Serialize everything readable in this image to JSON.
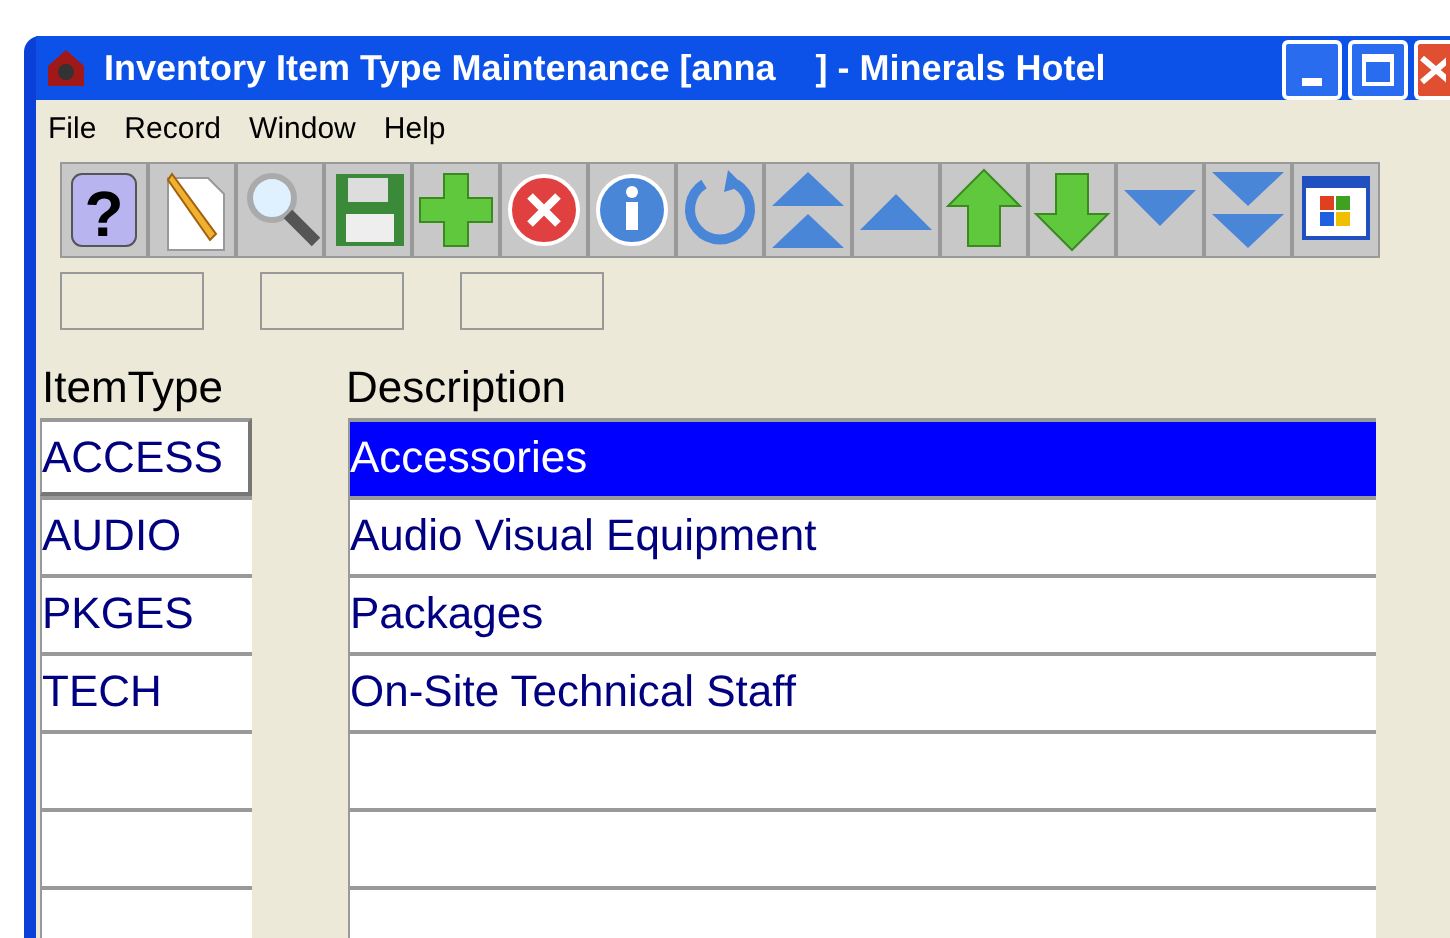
{
  "window": {
    "title": "Inventory Item Type Maintenance [anna    ] - Minerals Hotel"
  },
  "menu": [
    "File",
    "Record",
    "Window",
    "Help"
  ],
  "toolbar": {
    "help_glyph": "?"
  },
  "columns": [
    "ItemType",
    "Description"
  ],
  "rows": [
    {
      "item_type": "ACCESS",
      "description": "Accessories",
      "selected": true
    },
    {
      "item_type": "AUDIO",
      "description": "Audio Visual Equipment",
      "selected": false
    },
    {
      "item_type": "PKGES",
      "description": "Packages",
      "selected": false
    },
    {
      "item_type": "TECH",
      "description": "On-Site Technical Staff",
      "selected": false
    },
    {
      "item_type": "",
      "description": "",
      "selected": false
    },
    {
      "item_type": "",
      "description": "",
      "selected": false
    },
    {
      "item_type": "",
      "description": "",
      "selected": false
    }
  ]
}
